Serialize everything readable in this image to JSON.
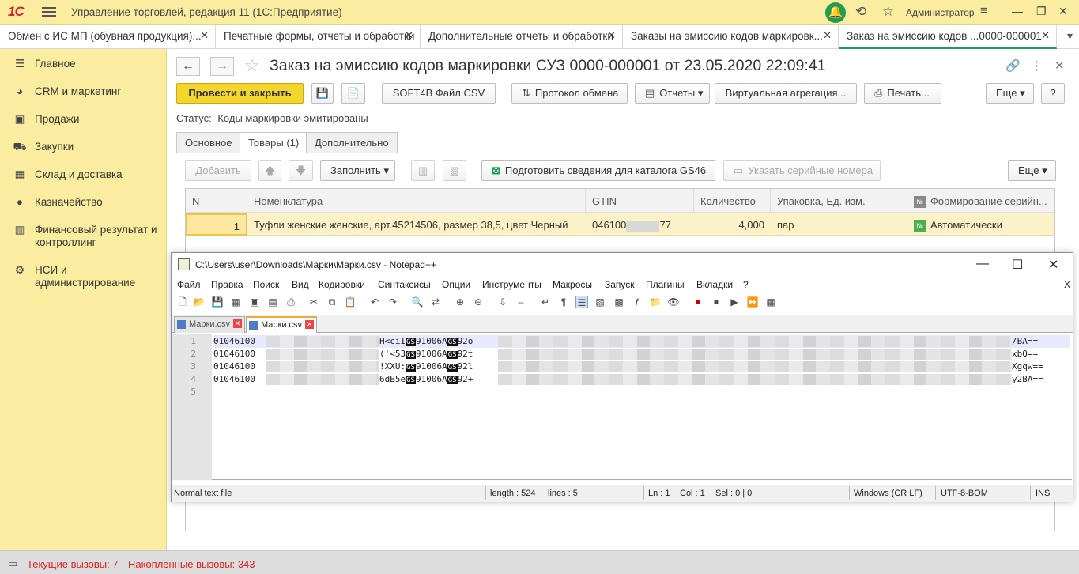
{
  "app": {
    "logo": "1С",
    "title": "Управление торговлей, редакция 11  (1С:Предприятие)",
    "user": "Администратор"
  },
  "open_tabs": [
    {
      "label": "Обмен с ИС МП (обувная продукция)..."
    },
    {
      "label": "Печатные формы, отчеты и обработки"
    },
    {
      "label": "Дополнительные отчеты и обработки"
    },
    {
      "label": "Заказы на эмиссию кодов маркировк..."
    },
    {
      "label": "Заказ на эмиссию кодов ...0000-000001"
    }
  ],
  "sidebar": {
    "items": [
      {
        "label": "Главное"
      },
      {
        "label": "CRM и маркетинг"
      },
      {
        "label": "Продажи"
      },
      {
        "label": "Закупки"
      },
      {
        "label": "Склад и доставка"
      },
      {
        "label": "Казначейство"
      },
      {
        "label": "Финансовый результат и контроллинг"
      },
      {
        "label": "НСИ и администрирование"
      }
    ]
  },
  "form": {
    "title": "Заказ на эмиссию кодов маркировки СУЗ 0000-000001 от 23.05.2020 22:09:41",
    "buttons": {
      "post_close": "Провести и закрыть",
      "soft4b": "SOFT4B Файл CSV",
      "exchange_protocol": "Протокол обмена",
      "reports": "Отчеты",
      "virtual_aggregation": "Виртуальная агрегация...",
      "print": "Печать...",
      "more": "Еще",
      "help": "?"
    },
    "status_label": "Статус:",
    "status_value": "Коды маркировки эмитированы",
    "tabs": [
      "Основное",
      "Товары (1)",
      "Дополнительно"
    ],
    "goods_toolbar": {
      "add": "Добавить",
      "fill": "Заполнить",
      "prepare_gs46": "Подготовить сведения для каталога GS46",
      "serial_numbers": "Указать серийные номера",
      "more": "Еще"
    },
    "grid": {
      "headers": [
        "N",
        "Номенклатура",
        "GTIN",
        "Количество",
        "Упаковка, Ед. изм.",
        "Формирование серийн..."
      ],
      "rows": [
        {
          "n": "1",
          "item": "Туфли женские женские, арт.45214506, размер 38,5, цвет Черный",
          "gtin_prefix": "046100",
          "gtin_suffix": "77",
          "qty": "4,000",
          "unit": "пар",
          "serial_mode": "Автоматически"
        }
      ]
    }
  },
  "notepad": {
    "title": "C:\\Users\\user\\Downloads\\Марки\\Марки.csv - Notepad++",
    "menu": [
      "Файл",
      "Правка",
      "Поиск",
      "Вид",
      "Кодировки",
      "Синтаксисы",
      "Опции",
      "Инструменты",
      "Макросы",
      "Запуск",
      "Плагины",
      "Вкладки",
      "?"
    ],
    "menu_close": "X",
    "doc_tabs": [
      "Марки.csv",
      "Марки.csv"
    ],
    "lines": [
      {
        "n": "1",
        "a": "01046100",
        "b": "H<ciI",
        "c": "91006A",
        "d": "92o",
        "e": "/BA=="
      },
      {
        "n": "2",
        "a": "01046100",
        "b": "('<53",
        "c": "91006A",
        "d": "92t",
        "e": "xbQ=="
      },
      {
        "n": "3",
        "a": "01046100",
        "b": "!XXU:",
        "c": "91006A",
        "d": "92l",
        "e": "Xgqw=="
      },
      {
        "n": "4",
        "a": "01046100",
        "b": "6dB5e",
        "c": "91006A",
        "d": "92+",
        "e": "y2BA=="
      },
      {
        "n": "5"
      }
    ],
    "gs_mark": "GS",
    "status": {
      "file_type": "Normal text file",
      "length": "length : 524",
      "lines": "lines : 5",
      "ln": "Ln : 1",
      "col": "Col : 1",
      "sel": "Sel : 0 | 0",
      "eol": "Windows (CR LF)",
      "encoding": "UTF-8-BOM",
      "mode": "INS"
    }
  },
  "bottom": {
    "current_calls": "Текущие вызовы: 7",
    "accumulated_calls": "Накопленные вызовы: 343"
  },
  "colors": {
    "brand_yellow": "#fbeda0",
    "primary_button": "#f3d52b",
    "accent_green": "#1f9d55",
    "alert_red": "#d22222"
  }
}
